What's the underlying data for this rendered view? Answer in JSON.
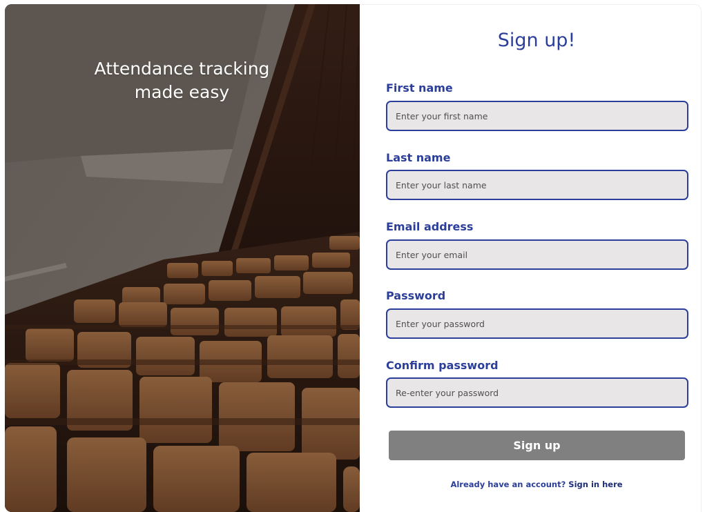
{
  "hero": {
    "title_line1": "Attendance tracking",
    "title_line2": "made easy"
  },
  "form": {
    "title": "Sign up!",
    "fields": [
      {
        "label": "First name",
        "placeholder": "Enter your first name",
        "value": ""
      },
      {
        "label": "Last name",
        "placeholder": "Enter your last name",
        "value": ""
      },
      {
        "label": "Email address",
        "placeholder": "Enter your email",
        "value": ""
      },
      {
        "label": "Password",
        "placeholder": "Enter your password",
        "value": ""
      },
      {
        "label": "Confirm password",
        "placeholder": "Re-enter your password",
        "value": ""
      }
    ],
    "submit_label": "Sign up",
    "signin_prompt": "Already have an account?",
    "signin_link": "Sign in here"
  },
  "colors": {
    "accent": "#2b3f9a",
    "input_bg": "#e9e6e7",
    "button_bg": "#808080"
  }
}
